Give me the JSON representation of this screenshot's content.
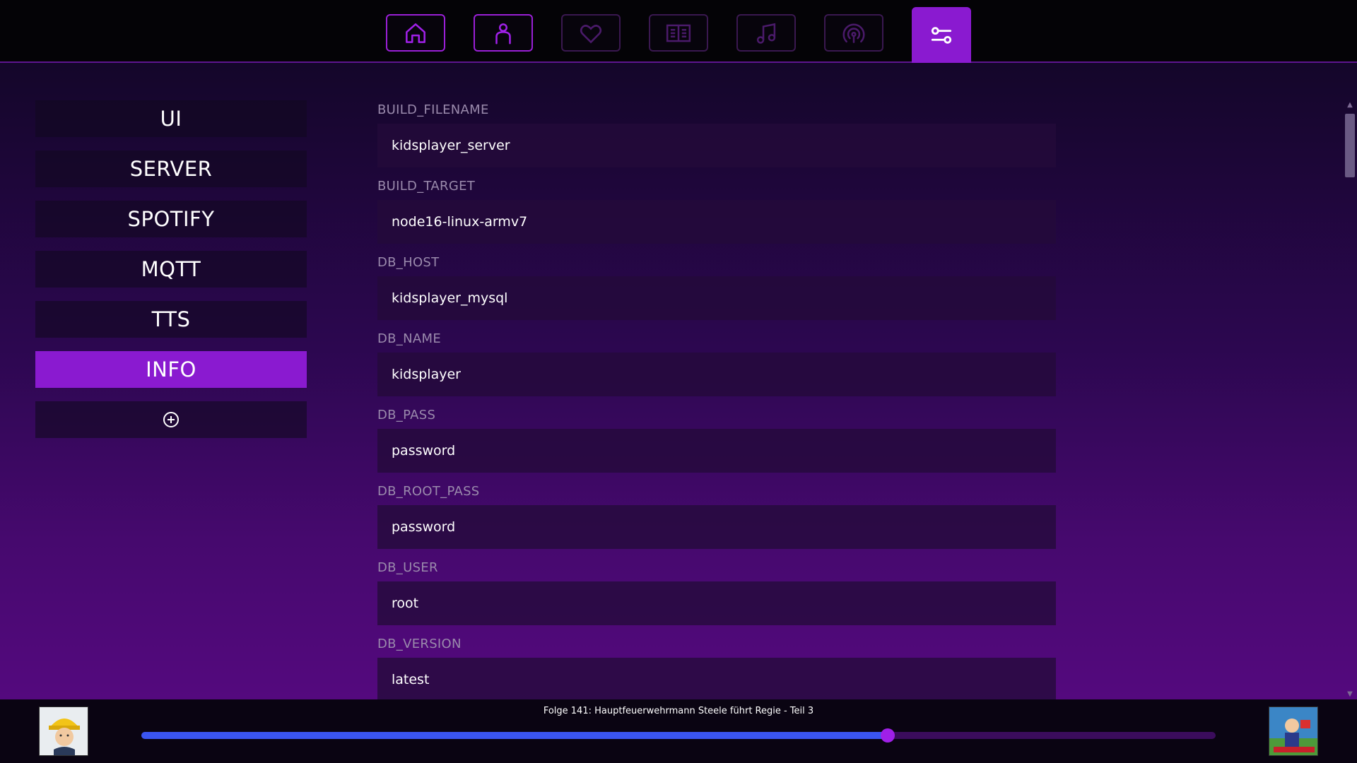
{
  "nav": {
    "tabs": [
      {
        "icon": "home-icon",
        "state": "highlighted"
      },
      {
        "icon": "person-icon",
        "state": "highlighted"
      },
      {
        "icon": "heart-icon",
        "state": "normal"
      },
      {
        "icon": "book-icon",
        "state": "normal"
      },
      {
        "icon": "music-note-icon",
        "state": "normal"
      },
      {
        "icon": "podcast-icon",
        "state": "normal"
      },
      {
        "icon": "settings-sliders-icon",
        "state": "active"
      }
    ]
  },
  "sidebar": {
    "items": [
      {
        "label": "UI"
      },
      {
        "label": "SERVER"
      },
      {
        "label": "SPOTIFY"
      },
      {
        "label": "MQTT"
      },
      {
        "label": "TTS"
      },
      {
        "label": "INFO",
        "active": true
      }
    ],
    "add_icon": "add-circle-icon"
  },
  "fields": [
    {
      "label": "BUILD_FILENAME",
      "value": "kidsplayer_server"
    },
    {
      "label": "BUILD_TARGET",
      "value": "node16-linux-armv7"
    },
    {
      "label": "DB_HOST",
      "value": "kidsplayer_mysql"
    },
    {
      "label": "DB_NAME",
      "value": "kidsplayer"
    },
    {
      "label": "DB_PASS",
      "value": "password"
    },
    {
      "label": "DB_ROOT_PASS",
      "value": "password"
    },
    {
      "label": "DB_USER",
      "value": "root"
    },
    {
      "label": "DB_VERSION",
      "value": "latest"
    }
  ],
  "player": {
    "title": "Folge 141: Hauptfeuerwehrmann Steele führt Regie - Teil 3",
    "progress_percent": 69.5
  },
  "colors": {
    "accent": "#8a1ad0",
    "progress": "#3a55f0",
    "knob": "#a020e8"
  }
}
